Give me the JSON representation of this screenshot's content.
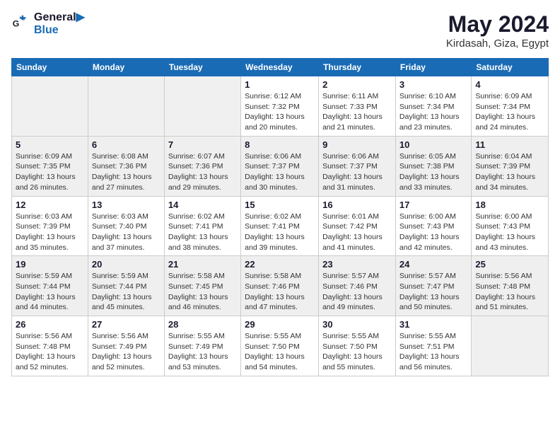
{
  "header": {
    "logo_line1": "General",
    "logo_line2": "Blue",
    "month": "May 2024",
    "location": "Kirdasah, Giza, Egypt"
  },
  "weekdays": [
    "Sunday",
    "Monday",
    "Tuesday",
    "Wednesday",
    "Thursday",
    "Friday",
    "Saturday"
  ],
  "weeks": [
    [
      {
        "day": "",
        "empty": true
      },
      {
        "day": "",
        "empty": true
      },
      {
        "day": "",
        "empty": true
      },
      {
        "day": "1",
        "sunrise": "6:12 AM",
        "sunset": "7:32 PM",
        "daylight": "13 hours and 20 minutes."
      },
      {
        "day": "2",
        "sunrise": "6:11 AM",
        "sunset": "7:33 PM",
        "daylight": "13 hours and 21 minutes."
      },
      {
        "day": "3",
        "sunrise": "6:10 AM",
        "sunset": "7:34 PM",
        "daylight": "13 hours and 23 minutes."
      },
      {
        "day": "4",
        "sunrise": "6:09 AM",
        "sunset": "7:34 PM",
        "daylight": "13 hours and 24 minutes."
      }
    ],
    [
      {
        "day": "5",
        "sunrise": "6:09 AM",
        "sunset": "7:35 PM",
        "daylight": "13 hours and 26 minutes."
      },
      {
        "day": "6",
        "sunrise": "6:08 AM",
        "sunset": "7:36 PM",
        "daylight": "13 hours and 27 minutes."
      },
      {
        "day": "7",
        "sunrise": "6:07 AM",
        "sunset": "7:36 PM",
        "daylight": "13 hours and 29 minutes."
      },
      {
        "day": "8",
        "sunrise": "6:06 AM",
        "sunset": "7:37 PM",
        "daylight": "13 hours and 30 minutes."
      },
      {
        "day": "9",
        "sunrise": "6:06 AM",
        "sunset": "7:37 PM",
        "daylight": "13 hours and 31 minutes."
      },
      {
        "day": "10",
        "sunrise": "6:05 AM",
        "sunset": "7:38 PM",
        "daylight": "13 hours and 33 minutes."
      },
      {
        "day": "11",
        "sunrise": "6:04 AM",
        "sunset": "7:39 PM",
        "daylight": "13 hours and 34 minutes."
      }
    ],
    [
      {
        "day": "12",
        "sunrise": "6:03 AM",
        "sunset": "7:39 PM",
        "daylight": "13 hours and 35 minutes."
      },
      {
        "day": "13",
        "sunrise": "6:03 AM",
        "sunset": "7:40 PM",
        "daylight": "13 hours and 37 minutes."
      },
      {
        "day": "14",
        "sunrise": "6:02 AM",
        "sunset": "7:41 PM",
        "daylight": "13 hours and 38 minutes."
      },
      {
        "day": "15",
        "sunrise": "6:02 AM",
        "sunset": "7:41 PM",
        "daylight": "13 hours and 39 minutes."
      },
      {
        "day": "16",
        "sunrise": "6:01 AM",
        "sunset": "7:42 PM",
        "daylight": "13 hours and 41 minutes."
      },
      {
        "day": "17",
        "sunrise": "6:00 AM",
        "sunset": "7:43 PM",
        "daylight": "13 hours and 42 minutes."
      },
      {
        "day": "18",
        "sunrise": "6:00 AM",
        "sunset": "7:43 PM",
        "daylight": "13 hours and 43 minutes."
      }
    ],
    [
      {
        "day": "19",
        "sunrise": "5:59 AM",
        "sunset": "7:44 PM",
        "daylight": "13 hours and 44 minutes."
      },
      {
        "day": "20",
        "sunrise": "5:59 AM",
        "sunset": "7:44 PM",
        "daylight": "13 hours and 45 minutes."
      },
      {
        "day": "21",
        "sunrise": "5:58 AM",
        "sunset": "7:45 PM",
        "daylight": "13 hours and 46 minutes."
      },
      {
        "day": "22",
        "sunrise": "5:58 AM",
        "sunset": "7:46 PM",
        "daylight": "13 hours and 47 minutes."
      },
      {
        "day": "23",
        "sunrise": "5:57 AM",
        "sunset": "7:46 PM",
        "daylight": "13 hours and 49 minutes."
      },
      {
        "day": "24",
        "sunrise": "5:57 AM",
        "sunset": "7:47 PM",
        "daylight": "13 hours and 50 minutes."
      },
      {
        "day": "25",
        "sunrise": "5:56 AM",
        "sunset": "7:48 PM",
        "daylight": "13 hours and 51 minutes."
      }
    ],
    [
      {
        "day": "26",
        "sunrise": "5:56 AM",
        "sunset": "7:48 PM",
        "daylight": "13 hours and 52 minutes."
      },
      {
        "day": "27",
        "sunrise": "5:56 AM",
        "sunset": "7:49 PM",
        "daylight": "13 hours and 52 minutes."
      },
      {
        "day": "28",
        "sunrise": "5:55 AM",
        "sunset": "7:49 PM",
        "daylight": "13 hours and 53 minutes."
      },
      {
        "day": "29",
        "sunrise": "5:55 AM",
        "sunset": "7:50 PM",
        "daylight": "13 hours and 54 minutes."
      },
      {
        "day": "30",
        "sunrise": "5:55 AM",
        "sunset": "7:50 PM",
        "daylight": "13 hours and 55 minutes."
      },
      {
        "day": "31",
        "sunrise": "5:55 AM",
        "sunset": "7:51 PM",
        "daylight": "13 hours and 56 minutes."
      },
      {
        "day": "",
        "empty": true
      }
    ]
  ],
  "labels": {
    "sunrise": "Sunrise:",
    "sunset": "Sunset:",
    "daylight": "Daylight:"
  }
}
